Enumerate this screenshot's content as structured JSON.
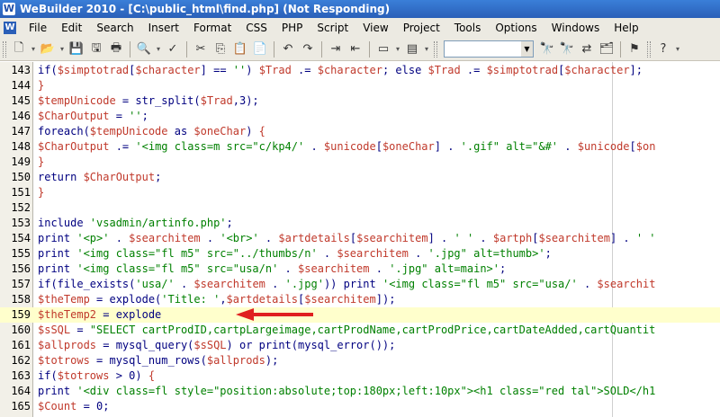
{
  "window": {
    "title": "WeBuilder 2010 - [C:\\public_html\\find.php] (Not Responding)",
    "app_icon": "webuilder-logo-icon"
  },
  "menu": [
    "File",
    "Edit",
    "Search",
    "Insert",
    "Format",
    "CSS",
    "PHP",
    "Script",
    "View",
    "Project",
    "Tools",
    "Options",
    "Windows",
    "Help"
  ],
  "toolbar": {
    "icons": [
      "new-document-icon",
      "open-folder-icon",
      "save-icon",
      "save-all-icon",
      "print-icon",
      "preview-icon",
      "spellcheck-icon",
      "cut-icon",
      "copy-icon",
      "paste-icon",
      "paste-special-icon",
      "undo-icon",
      "redo-icon",
      "indent-icon",
      "outdent-icon",
      "window-icon",
      "layout-icon",
      "find-icon",
      "find-next-icon",
      "replace-icon",
      "find-in-files-icon",
      "bookmark-icon",
      "help-icon"
    ],
    "search_combo_value": ""
  },
  "colors": {
    "keyword": "#000080",
    "variable": "#c0392b",
    "string": "#008000",
    "current_line": "#ffffcc",
    "arrow": "#e02020"
  },
  "editor": {
    "current_line_number": "159",
    "lines": [
      {
        "n": "143",
        "code": [
          [
            "kw",
            "if("
          ],
          [
            "var",
            "$simptotrad"
          ],
          [
            "kw",
            "["
          ],
          [
            "var",
            "$character"
          ],
          [
            "kw",
            "] == "
          ],
          [
            "str",
            "''"
          ],
          [
            "kw",
            ") "
          ],
          [
            "var",
            "$Trad"
          ],
          [
            "kw",
            " .= "
          ],
          [
            "var",
            "$character"
          ],
          [
            "kw",
            "; else "
          ],
          [
            "var",
            "$Trad"
          ],
          [
            "kw",
            " .= "
          ],
          [
            "var",
            "$simptotrad"
          ],
          [
            "kw",
            "["
          ],
          [
            "var",
            "$character"
          ],
          [
            "kw",
            "];"
          ]
        ]
      },
      {
        "n": "144",
        "code": [
          [
            "var",
            "}"
          ]
        ]
      },
      {
        "n": "145",
        "code": [
          [
            "var",
            "$tempUnicode"
          ],
          [
            "kw",
            " = str_split("
          ],
          [
            "var",
            "$Trad"
          ],
          [
            "kw",
            ",3);"
          ]
        ]
      },
      {
        "n": "146",
        "code": [
          [
            "var",
            "$CharOutput"
          ],
          [
            "kw",
            " = "
          ],
          [
            "str",
            "''"
          ],
          [
            "kw",
            ";"
          ]
        ]
      },
      {
        "n": "147",
        "code": [
          [
            "kw",
            "foreach("
          ],
          [
            "var",
            "$tempUnicode"
          ],
          [
            "kw",
            " as "
          ],
          [
            "var",
            "$oneChar"
          ],
          [
            "kw",
            ") "
          ],
          [
            "var",
            "{"
          ]
        ]
      },
      {
        "n": "148",
        "code": [
          [
            "var",
            "$CharOutput"
          ],
          [
            "kw",
            " .= "
          ],
          [
            "str",
            "'<img class=m src=\"c/kp4/'"
          ],
          [
            "kw",
            " . "
          ],
          [
            "var",
            "$unicode"
          ],
          [
            "kw",
            "["
          ],
          [
            "var",
            "$oneChar"
          ],
          [
            "kw",
            "] . "
          ],
          [
            "str",
            "'.gif\" alt=\"&#'"
          ],
          [
            "kw",
            " . "
          ],
          [
            "var",
            "$unicode"
          ],
          [
            "kw",
            "["
          ],
          [
            "var",
            "$on"
          ]
        ]
      },
      {
        "n": "149",
        "code": [
          [
            "var",
            "}"
          ]
        ]
      },
      {
        "n": "150",
        "code": [
          [
            "kw",
            "return "
          ],
          [
            "var",
            "$CharOutput"
          ],
          [
            "kw",
            ";"
          ]
        ]
      },
      {
        "n": "151",
        "code": [
          [
            "var",
            "}"
          ]
        ]
      },
      {
        "n": "152",
        "code": []
      },
      {
        "n": "153",
        "code": [
          [
            "kw",
            "include "
          ],
          [
            "str",
            "'vsadmin/artinfo.php'"
          ],
          [
            "kw",
            ";"
          ]
        ]
      },
      {
        "n": "154",
        "code": [
          [
            "kw",
            "print "
          ],
          [
            "str",
            "'<p>'"
          ],
          [
            "kw",
            " . "
          ],
          [
            "var",
            "$searchitem"
          ],
          [
            "kw",
            " . "
          ],
          [
            "str",
            "'<br>'"
          ],
          [
            "kw",
            " . "
          ],
          [
            "var",
            "$artdetails"
          ],
          [
            "kw",
            "["
          ],
          [
            "var",
            "$searchitem"
          ],
          [
            "kw",
            "] . "
          ],
          [
            "str",
            "' '"
          ],
          [
            "kw",
            " . "
          ],
          [
            "var",
            "$artph"
          ],
          [
            "kw",
            "["
          ],
          [
            "var",
            "$searchitem"
          ],
          [
            "kw",
            "] . "
          ],
          [
            "str",
            "' '"
          ]
        ]
      },
      {
        "n": "155",
        "code": [
          [
            "kw",
            "print "
          ],
          [
            "str",
            "'<img class=\"fl m5\" src=\"../thumbs/n'"
          ],
          [
            "kw",
            " . "
          ],
          [
            "var",
            "$searchitem"
          ],
          [
            "kw",
            " . "
          ],
          [
            "str",
            "'.jpg\" alt=thumb>'"
          ],
          [
            "kw",
            ";"
          ]
        ]
      },
      {
        "n": "156",
        "code": [
          [
            "kw",
            "print "
          ],
          [
            "str",
            "'<img class=\"fl m5\" src=\"usa/n'"
          ],
          [
            "kw",
            " . "
          ],
          [
            "var",
            "$searchitem"
          ],
          [
            "kw",
            " . "
          ],
          [
            "str",
            "'.jpg\" alt=main>'"
          ],
          [
            "kw",
            ";"
          ]
        ]
      },
      {
        "n": "157",
        "code": [
          [
            "kw",
            "if(file_exists("
          ],
          [
            "str",
            "'usa/'"
          ],
          [
            "kw",
            " . "
          ],
          [
            "var",
            "$searchitem"
          ],
          [
            "kw",
            " . "
          ],
          [
            "str",
            "'.jpg'"
          ],
          [
            "kw",
            ")) print "
          ],
          [
            "str",
            "'<img class=\"fl m5\" src=\"usa/'"
          ],
          [
            "kw",
            " . "
          ],
          [
            "var",
            "$searchit"
          ]
        ]
      },
      {
        "n": "158",
        "code": [
          [
            "var",
            "$theTemp"
          ],
          [
            "kw",
            " = explode("
          ],
          [
            "str",
            "'Title: '"
          ],
          [
            "kw",
            ","
          ],
          [
            "var",
            "$artdetails"
          ],
          [
            "kw",
            "["
          ],
          [
            "var",
            "$searchitem"
          ],
          [
            "kw",
            "]);"
          ]
        ]
      },
      {
        "n": "159",
        "code": [
          [
            "var",
            "$theTemp2"
          ],
          [
            "kw",
            " = explode"
          ]
        ]
      },
      {
        "n": "160",
        "code": [
          [
            "var",
            "$sSQL"
          ],
          [
            "kw",
            " = "
          ],
          [
            "str",
            "\"SELECT cartProdID,cartpLargeimage,cartProdName,cartProdPrice,cartDateAdded,cartQuantit"
          ]
        ]
      },
      {
        "n": "161",
        "code": [
          [
            "var",
            "$allprods"
          ],
          [
            "kw",
            " = mysql_query("
          ],
          [
            "var",
            "$sSQL"
          ],
          [
            "kw",
            ") or print(mysql_error());"
          ]
        ]
      },
      {
        "n": "162",
        "code": [
          [
            "var",
            "$totrows"
          ],
          [
            "kw",
            " = mysql_num_rows("
          ],
          [
            "var",
            "$allprods"
          ],
          [
            "kw",
            ");"
          ]
        ]
      },
      {
        "n": "163",
        "code": [
          [
            "kw",
            "if("
          ],
          [
            "var",
            "$totrows"
          ],
          [
            "kw",
            " > 0) "
          ],
          [
            "var",
            "{"
          ]
        ]
      },
      {
        "n": "164",
        "code": [
          [
            "kw",
            "print "
          ],
          [
            "str",
            "'<div class=fl style=\"position:absolute;top:180px;left:10px\"><h1 class=\"red tal\">SOLD</h1"
          ]
        ]
      },
      {
        "n": "165",
        "code": [
          [
            "var",
            "$Count"
          ],
          [
            "kw",
            " = 0;"
          ]
        ]
      }
    ]
  }
}
